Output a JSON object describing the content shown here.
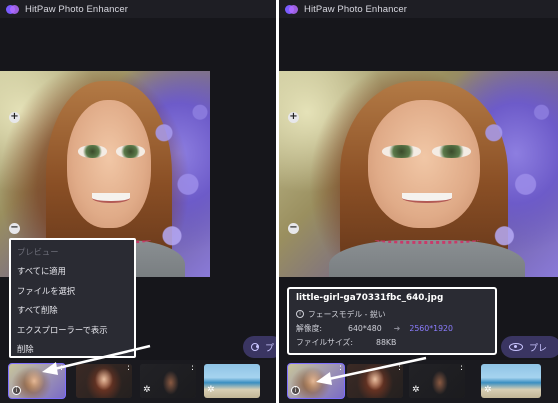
{
  "app": {
    "title": "HitPaw Photo Enhancer",
    "accent": "#7f70ff"
  },
  "zoom": {
    "in": "+",
    "out": "−"
  },
  "context_menu": {
    "items": [
      {
        "label": "プレビュー",
        "enabled": false
      },
      {
        "label": "すべてに適用",
        "enabled": true
      },
      {
        "label": "ファイルを選択",
        "enabled": true
      },
      {
        "label": "すべて削除",
        "enabled": true
      },
      {
        "label": "エクスプローラーで表示",
        "enabled": true
      },
      {
        "label": "削除",
        "enabled": true
      }
    ]
  },
  "preview_button": {
    "label": "プレビュー",
    "label_visible": "プレ",
    "icon": "eye-icon"
  },
  "thumbnails": [
    {
      "name": "girl-flowers",
      "selected": true,
      "icon": "info-icon"
    },
    {
      "name": "red-hair-portrait",
      "selected": false,
      "icon": "more-icon"
    },
    {
      "name": "dark-portrait",
      "selected": false,
      "icon": "gear-icon"
    },
    {
      "name": "beach",
      "selected": false,
      "icon": "gear-icon"
    }
  ],
  "file_info": {
    "filename": "little-girl-ga70331fbc_640.jpg",
    "model": "フェースモデル - 鋭い",
    "resolution_label": "解像度:",
    "resolution_original": "640*480",
    "resolution_enhanced": "2560*1920",
    "filesize_label": "ファイルサイズ:",
    "filesize": "88KB"
  }
}
